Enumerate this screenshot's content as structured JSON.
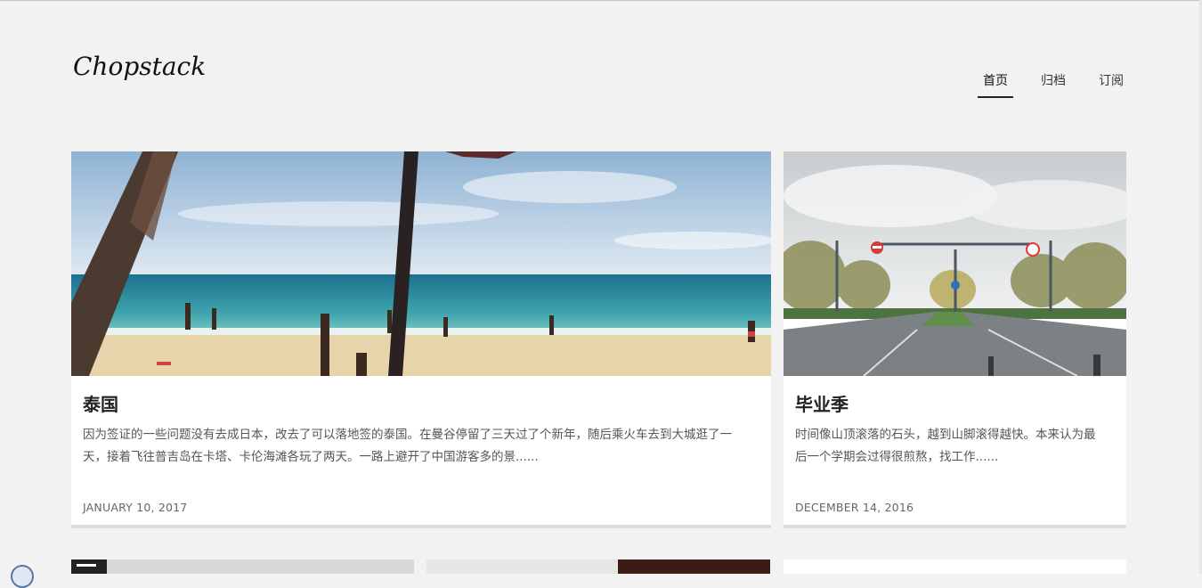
{
  "site": {
    "logo": "Chopstack"
  },
  "nav": {
    "items": [
      {
        "label": "首页",
        "active": true
      },
      {
        "label": "归档",
        "active": false
      },
      {
        "label": "订阅",
        "active": false
      }
    ]
  },
  "posts": [
    {
      "title": "泰国",
      "excerpt_line1": "因为签证的一些问题没有去成日本，改去了可以落地签的泰国。在曼谷停留了三天过了个新年，随后乘火车去到大城逛了一",
      "excerpt_line2": "天，接着飞往普吉岛在卡塔、卡伦海滩各玩了两天。一路上避开了中国游客多的景......",
      "date": "JANUARY 10, 2017",
      "image": "beach-photo"
    },
    {
      "title": "毕业季",
      "excerpt_line1": "时间像山顶滚落的石头，越到山脚滚得越快。本来认为最",
      "excerpt_line2": "后一个学期会过得很煎熬，找工作......",
      "date": "DECEMBER 14, 2016",
      "image": "road-photo"
    }
  ],
  "colors": {
    "background": "#f2f2f2",
    "card": "#ffffff",
    "text": "#222222",
    "muted": "#666666"
  }
}
